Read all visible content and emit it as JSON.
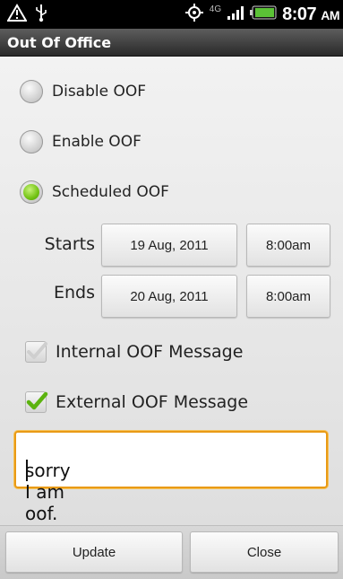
{
  "status_bar": {
    "time": "8:07",
    "ampm": "AM",
    "network": "4G",
    "icons": [
      "warning-icon",
      "usb-icon",
      "gps-icon",
      "signal-icon",
      "battery-icon"
    ]
  },
  "title": "Out Of Office",
  "options": [
    {
      "label": "Disable OOF",
      "selected": false
    },
    {
      "label": "Enable OOF",
      "selected": false
    },
    {
      "label": "Scheduled OOF",
      "selected": true
    }
  ],
  "schedule": {
    "starts_label": "Starts",
    "starts_date": "19 Aug, 2011",
    "starts_time": "8:00am",
    "ends_label": "Ends",
    "ends_date": "20 Aug, 2011",
    "ends_time": "8:00am"
  },
  "messages": {
    "internal_label": "Internal OOF Message",
    "internal_checked": true,
    "internal_enabled": false,
    "external_label": "External OOF Message",
    "external_checked": true
  },
  "message_text": "sorry I am oof. oops",
  "buttons": {
    "update": "Update",
    "close": "Close"
  },
  "colors": {
    "selected_green": "#72c313",
    "focus_orange": "#e99a16"
  }
}
